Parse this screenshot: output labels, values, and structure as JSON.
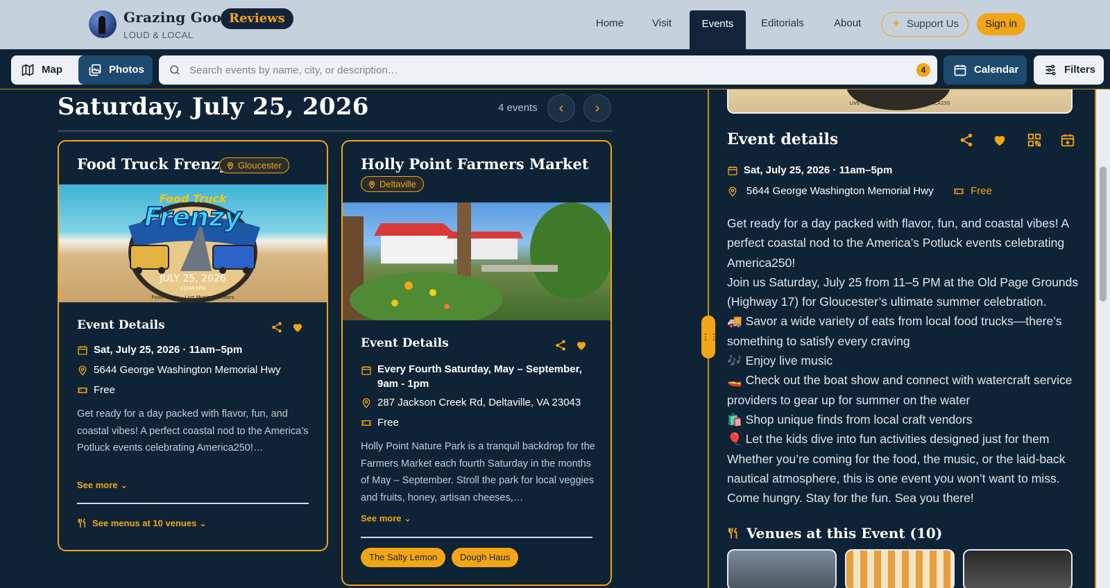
{
  "header": {
    "brand_name": "Grazing Goose",
    "brand_badge": "Reviews",
    "brand_sub": "LOUD & LOCAL",
    "nav": [
      "Home",
      "Visit",
      "Events",
      "Editorials",
      "About"
    ],
    "active_nav": "Events",
    "support_label": "Support Us",
    "signin_label": "Sign in"
  },
  "toolbar": {
    "map_label": "Map",
    "photos_label": "Photos",
    "search_placeholder": "Search events by name, city, or description…",
    "search_value": "",
    "result_count": "4",
    "calendar_label": "Calendar",
    "filters_label": "Filters"
  },
  "day": {
    "title": "Saturday, July 25, 2026",
    "event_count": "4 events"
  },
  "cards": [
    {
      "title": "Food Truck Frenzy",
      "location": "Gloucester",
      "image_text": {
        "line1": "Food Truck",
        "line2": "Frenzy",
        "date": "JULY 25, 2026",
        "time": "11AM-5PM",
        "footer": "Food Trucks · Live Music · Vendors"
      },
      "section_title": "Event Details",
      "date": "Sat, July 25, 2026 · 11am–5pm",
      "address": "5644 George Washington Memorial Hwy",
      "price": "Free",
      "description": "Get ready for a day packed with flavor, fun, and coastal vibes! A perfect coastal nod to the America’s Potluck events celebrating America250!…",
      "see_more": "See more",
      "menus_label": "See menus at 10 venues"
    },
    {
      "title": "Holly Point Farmers Market",
      "location": "Deltaville",
      "section_title": "Event Details",
      "date": "Every Fourth Saturday, May – September, 9am - 1pm",
      "address": "287 Jackson Creek Rd, Deltaville, VA 23043",
      "price": "Free",
      "description": "Holly Point Nature Park is a tranquil backdrop for the Farmers Market each fourth Saturday in the months of May – September. Stroll the park for local veggies and fruits, honey, artisan cheeses,…",
      "see_more": "See more",
      "venues": [
        "The Salty Lemon",
        "Dough Haus"
      ]
    }
  ],
  "panel": {
    "image_text": "LIVE MU · COASTAL NOD TO AMERICA250",
    "title": "Event details",
    "date": "Sat, July 25, 2026 · 11am–5pm",
    "address": "5644 George Washington Memorial Hwy",
    "price": "Free",
    "description": [
      "Get ready for a day packed with flavor, fun, and coastal vibes! A perfect coastal nod to the America’s Potluck events celebrating America250!",
      "Join us Saturday, July 25 from 11–5 PM at the Old Page Grounds (Highway 17) for Gloucester’s ultimate summer celebration.",
      "🚚 Savor a wide variety of eats from local food trucks—there’s something to satisfy every craving",
      "🎶 Enjoy live music",
      "🚤 Check out the boat show and connect with watercraft service providers to gear up for summer on the water",
      "🛍️ Shop unique finds from local craft vendors",
      "🎈 Let the kids dive into fun activities designed just for them",
      "Whether you’re coming for the food, the music, or the laid-back nautical atmosphere, this is one event you won’t want to miss.",
      "Come hungry. Stay for the fun. Sea you there!"
    ],
    "venues_title": "Venues at this Event (10)"
  },
  "colors": {
    "accent": "#f2a516",
    "bg": "#0f2336",
    "header_bg": "#c5d1dc",
    "primary_btn": "#1e4a70"
  }
}
